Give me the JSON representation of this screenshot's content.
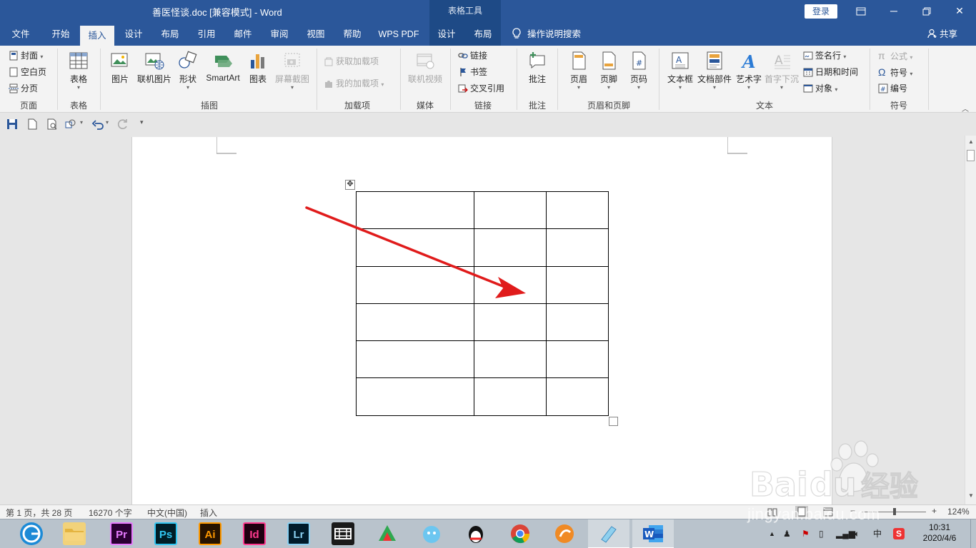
{
  "titlebar": {
    "doc_title": "善医怪谈.doc [兼容模式]  -  Word",
    "tools_label": "表格工具",
    "login": "登录"
  },
  "tabs": [
    "文件",
    "开始",
    "插入",
    "设计",
    "布局",
    "引用",
    "邮件",
    "审阅",
    "视图",
    "帮助",
    "WPS PDF",
    "设计",
    "布局"
  ],
  "active_tab": "插入",
  "tell_me": "操作说明搜索",
  "share": "共享",
  "ribbon": {
    "pages": {
      "cover": "封面",
      "blank": "空白页",
      "break": "分页",
      "label": "页面"
    },
    "tables": {
      "table": "表格",
      "label": "表格"
    },
    "illustrations": {
      "picture": "图片",
      "online_picture": "联机图片",
      "shapes": "形状",
      "smartart": "SmartArt",
      "chart": "图表",
      "screenshot": "屏幕截图",
      "label": "插图"
    },
    "addins": {
      "get": "获取加载项",
      "mine": "我的加载项",
      "label": "加载项"
    },
    "media": {
      "video": "联机视频",
      "label": "媒体"
    },
    "links": {
      "link": "链接",
      "bookmark": "书签",
      "crossref": "交叉引用",
      "label": "链接"
    },
    "comments": {
      "comment": "批注",
      "label": "批注"
    },
    "header_footer": {
      "header": "页眉",
      "footer": "页脚",
      "page_number": "页码",
      "label": "页眉和页脚"
    },
    "text": {
      "textbox": "文本框",
      "quickparts": "文档部件",
      "wordart": "艺术字",
      "dropcap": "首字下沉",
      "signature": "签名行",
      "datetime": "日期和时间",
      "object": "对象",
      "label": "文本"
    },
    "symbols": {
      "equation": "公式",
      "symbol": "符号",
      "number": "编号",
      "label": "符号"
    }
  },
  "document": {
    "table": {
      "rows": 6,
      "cols": 3
    }
  },
  "status": {
    "page": "第 1 页，共 28 页",
    "words": "16270 个字",
    "language": "中文(中国)",
    "mode": "插入",
    "zoom": "124%"
  },
  "taskbar": {
    "apps": [
      "Pr",
      "Ps",
      "Ai",
      "Id",
      "Lr"
    ],
    "ime": "中",
    "time": "10:31",
    "date": "2020/4/6"
  },
  "watermark": {
    "text": "jingyan.baidu.com",
    "brand": "经验"
  },
  "colors": {
    "accent": "#2b579a",
    "arrow": "#e01b1b"
  }
}
